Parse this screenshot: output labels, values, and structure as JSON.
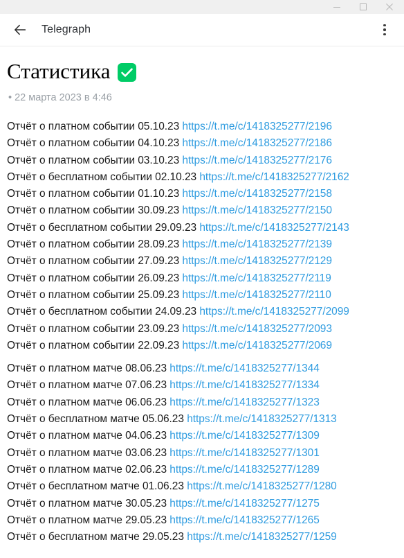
{
  "window": {
    "controls": [
      {
        "name": "minimize",
        "glyph": "minimize-icon"
      },
      {
        "name": "maximize",
        "glyph": "maximize-icon"
      },
      {
        "name": "close",
        "glyph": "close-icon"
      }
    ]
  },
  "appbar": {
    "back_icon": "arrow-left-icon",
    "title": "Telegraph",
    "menu_icon": "more-vertical-icon"
  },
  "article": {
    "title": "Статистика",
    "title_badge_icon": "white-heavy-check-mark-emoji",
    "title_badge_color": "#00cc66",
    "byline": "• 22 марта 2023 в 4:46",
    "link_color": "#2f9ce0",
    "blocks": [
      {
        "id": "events-block",
        "entries": [
          {
            "label": "Отчёт о платном событии 05.10.23",
            "url": "https://t.me/c/1418325277/2196"
          },
          {
            "label": "Отчёт о платном событии 04.10.23",
            "url": "https://t.me/c/1418325277/2186"
          },
          {
            "label": "Отчёт о платном событии 03.10.23",
            "url": "https://t.me/c/1418325277/2176"
          },
          {
            "label": "Отчёт о бесплатном событии 02.10.23",
            "url": "https://t.me/c/1418325277/2162"
          },
          {
            "label": "Отчёт о платном событии 01.10.23",
            "url": "https://t.me/c/1418325277/2158"
          },
          {
            "label": "Отчёт о платном событии 30.09.23",
            "url": "https://t.me/c/1418325277/2150"
          },
          {
            "label": "Отчёт о бесплатном событии 29.09.23",
            "url": "https://t.me/c/1418325277/2143"
          },
          {
            "label": "Отчёт о платном событии 28.09.23",
            "url": "https://t.me/c/1418325277/2139"
          },
          {
            "label": "Отчёт о платном событии 27.09.23",
            "url": "https://t.me/c/1418325277/2129"
          },
          {
            "label": "Отчёт о платном событии 26.09.23",
            "url": "https://t.me/c/1418325277/2119"
          },
          {
            "label": "Отчёт о платном событии 25.09.23",
            "url": "https://t.me/c/1418325277/2110"
          },
          {
            "label": "Отчёт о бесплатном событии 24.09.23",
            "url": "https://t.me/c/1418325277/2099"
          },
          {
            "label": "Отчёт о платном событии 23.09.23",
            "url": "https://t.me/c/1418325277/2093"
          },
          {
            "label": "Отчёт о платном событии 22.09.23",
            "url": "https://t.me/c/1418325277/2069"
          }
        ]
      },
      {
        "id": "matches-block",
        "entries": [
          {
            "label": "Отчёт о платном матче 08.06.23",
            "url": "https://t.me/c/1418325277/1344"
          },
          {
            "label": "Отчёт о платном матче 07.06.23",
            "url": "https://t.me/c/1418325277/1334"
          },
          {
            "label": "Отчёт о платном матче 06.06.23",
            "url": "https://t.me/c/1418325277/1323"
          },
          {
            "label": "Отчёт о бесплатном матче 05.06.23",
            "url": "https://t.me/c/1418325277/1313"
          },
          {
            "label": "Отчёт о платном матче 04.06.23",
            "url": "https://t.me/c/1418325277/1309"
          },
          {
            "label": "Отчёт о платном матче 03.06.23",
            "url": "https://t.me/c/1418325277/1301"
          },
          {
            "label": "Отчёт о платном матче 02.06.23",
            "url": "https://t.me/c/1418325277/1289"
          },
          {
            "label": "Отчёт о бесплатном матче 01.06.23",
            "url": "https://t.me/c/1418325277/1280"
          },
          {
            "label": "Отчёт о платном матче 30.05.23",
            "url": "https://t.me/c/1418325277/1275"
          },
          {
            "label": "Отчёт о платном матче 29.05.23",
            "url": "https://t.me/c/1418325277/1265"
          },
          {
            "label": "Отчёт о бесплатном матче 29.05.23",
            "url": "https://t.me/c/1418325277/1259"
          }
        ]
      }
    ]
  }
}
